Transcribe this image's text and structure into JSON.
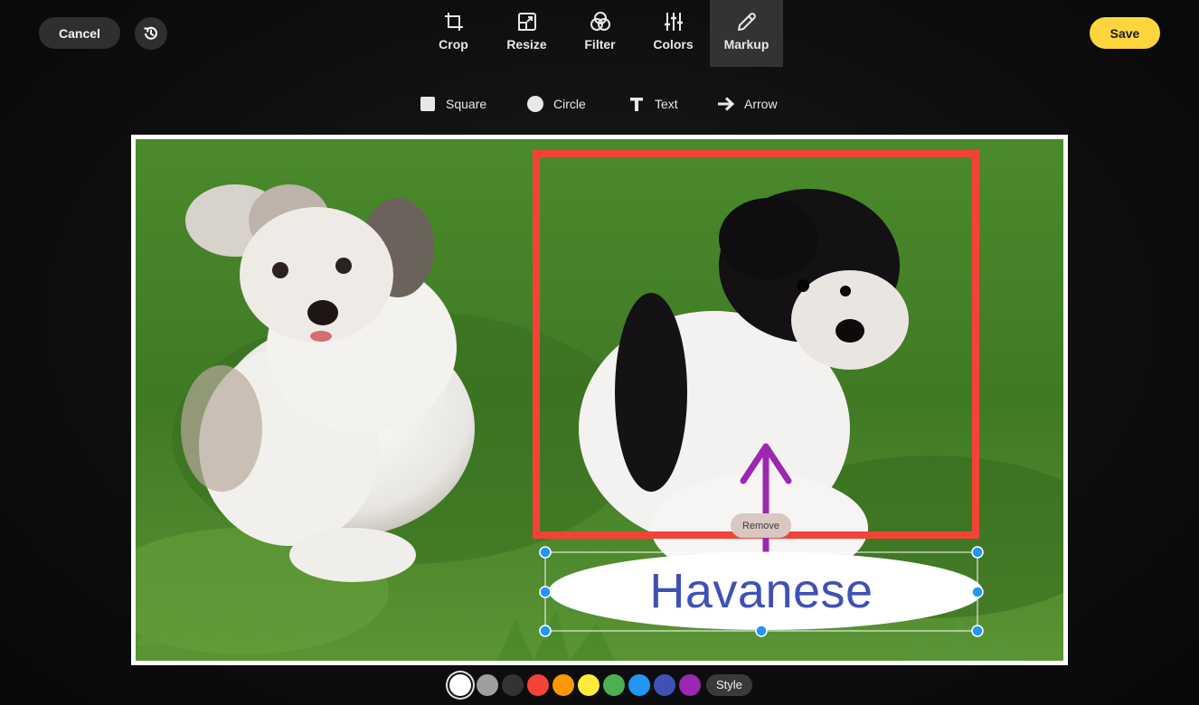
{
  "topbar": {
    "cancel_label": "Cancel",
    "save_label": "Save",
    "history_icon": "history-icon"
  },
  "tabs": [
    {
      "label": "Crop",
      "icon": "crop-icon",
      "active": false
    },
    {
      "label": "Resize",
      "icon": "resize-icon",
      "active": false
    },
    {
      "label": "Filter",
      "icon": "filter-icon",
      "active": false
    },
    {
      "label": "Colors",
      "icon": "sliders-icon",
      "active": false
    },
    {
      "label": "Markup",
      "icon": "pencil-icon",
      "active": true
    }
  ],
  "tools": [
    {
      "label": "Square",
      "icon": "square-icon"
    },
    {
      "label": "Circle",
      "icon": "circle-icon"
    },
    {
      "label": "Text",
      "icon": "text-icon"
    },
    {
      "label": "Arrow",
      "icon": "arrow-icon"
    }
  ],
  "canvas": {
    "remove_label": "Remove",
    "text_annotation": "Havanese",
    "rect_color": "#f44336",
    "arrow_color": "#9c27b0",
    "text_color": "#3f51b5",
    "handle_color": "#2196f3"
  },
  "palette": {
    "colors": [
      "#ffffff",
      "#9e9e9e",
      "#333333",
      "#f44336",
      "#ff9800",
      "#ffeb3b",
      "#4caf50",
      "#2196f3",
      "#3f51b5",
      "#9c27b0"
    ],
    "selected": "#ffffff",
    "style_label": "Style"
  }
}
